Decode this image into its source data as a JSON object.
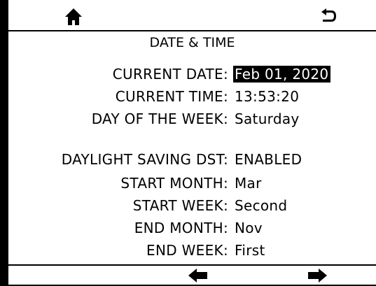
{
  "screen": {
    "title": "DATE & TIME",
    "settings": [
      {
        "label": "CURRENT DATE:",
        "value": "Feb 01, 2020",
        "selected": true
      },
      {
        "label": "CURRENT TIME:",
        "value": "13:53:20"
      },
      {
        "label": "DAY OF THE WEEK:",
        "value": "Saturday"
      },
      {
        "label": "DAYLIGHT SAVING DST:",
        "value": "ENABLED"
      },
      {
        "label": "START MONTH:",
        "value": "Mar"
      },
      {
        "label": "START WEEK:",
        "value": "Second"
      },
      {
        "label": "END MONTH:",
        "value": "Nov"
      },
      {
        "label": "END WEEK:",
        "value": "First"
      }
    ]
  },
  "icons": {
    "home": "home-icon",
    "back": "back-arrow-icon",
    "prev": "left-arrow-icon",
    "next": "right-arrow-icon"
  },
  "colors": {
    "background": "#ffffff",
    "foreground": "#000000",
    "selection": "#000000"
  }
}
